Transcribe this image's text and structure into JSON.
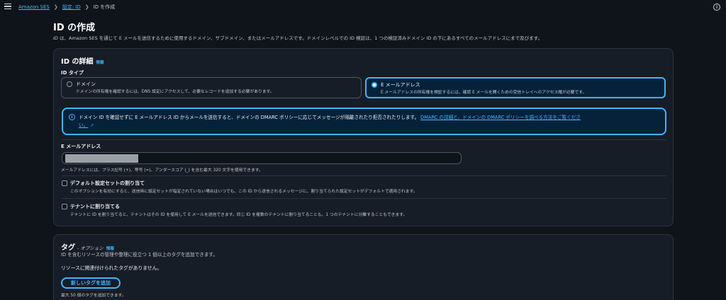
{
  "breadcrumb": {
    "items": [
      "Amazon SES",
      "設定: ID"
    ],
    "current": "ID を作成"
  },
  "page": {
    "title": "ID の作成",
    "description_prefix": "ID",
    "description": " は、Amazon SES を通じて E メールを送信するために使用するドメイン、サブドメイン、またはメールアドレスです。ドメインレベルでの ID 検証は、1 つの検証済みドメイン ID の下にあるすべてのメールアドレスにまで及びます。"
  },
  "details": {
    "title": "ID の詳細",
    "info": "情報",
    "id_type_label": "ID タイプ",
    "options": [
      {
        "title": "ドメイン",
        "desc": "ドメインの所有権を確認するには、DNS 設定にアクセスして、必要なレコードを追加する必要があります。",
        "selected": false
      },
      {
        "title": "E メールアドレス",
        "desc": "E メールアドレスの所有権を検証するには、確認 E メールを開くための受信トレイへのアクセス権が必要です。",
        "selected": true
      }
    ],
    "alert_text": "ドメイン ID を確認せずに E メールアドレス ID からメールを送信すると、ドメインの DMARC ポリシーに応じてメッセージが隔離されたり拒否されたりします。",
    "alert_link_1": "DMARC の詳細と、ドメインの DMARC ポリシーを調べる方法をご覧くださ",
    "alert_link_2": "い。",
    "email_label": "E メールアドレス",
    "email_hint": "メールアドレスには、プラス記号 (+)、等号 (=)、アンダースコア (_) を含む最大 320 文字を使用できます。",
    "default_config_label": "デフォルト設定セットの割り当て",
    "default_config_hint": "このオプションを有効にすると、送信時に設定セットが指定されていない場合はいつでも、この ID から送信されるメッセージに、割り当てられた設定セットがデフォルトで適用されます。",
    "tenant_label": "テナントに割り当てる",
    "tenant_hint": "テナントに ID を割り当てると、テナントはその ID を使用して E メールを送信できます。同じ ID を複数のテナントに割り当てることも、1 つのテナントに分離することもできます。"
  },
  "tags": {
    "title": "タグ",
    "optional": "- オプション",
    "info": "情報",
    "description": "ID を含むリソースの管理や整理に役立つ 1 個以上のタグを追加できます。",
    "empty": "リソースに関連付けられたタグがありません。",
    "add_button": "新しいタグを追加",
    "limit_hint": "最大 50 個のタグを追加できます。"
  }
}
